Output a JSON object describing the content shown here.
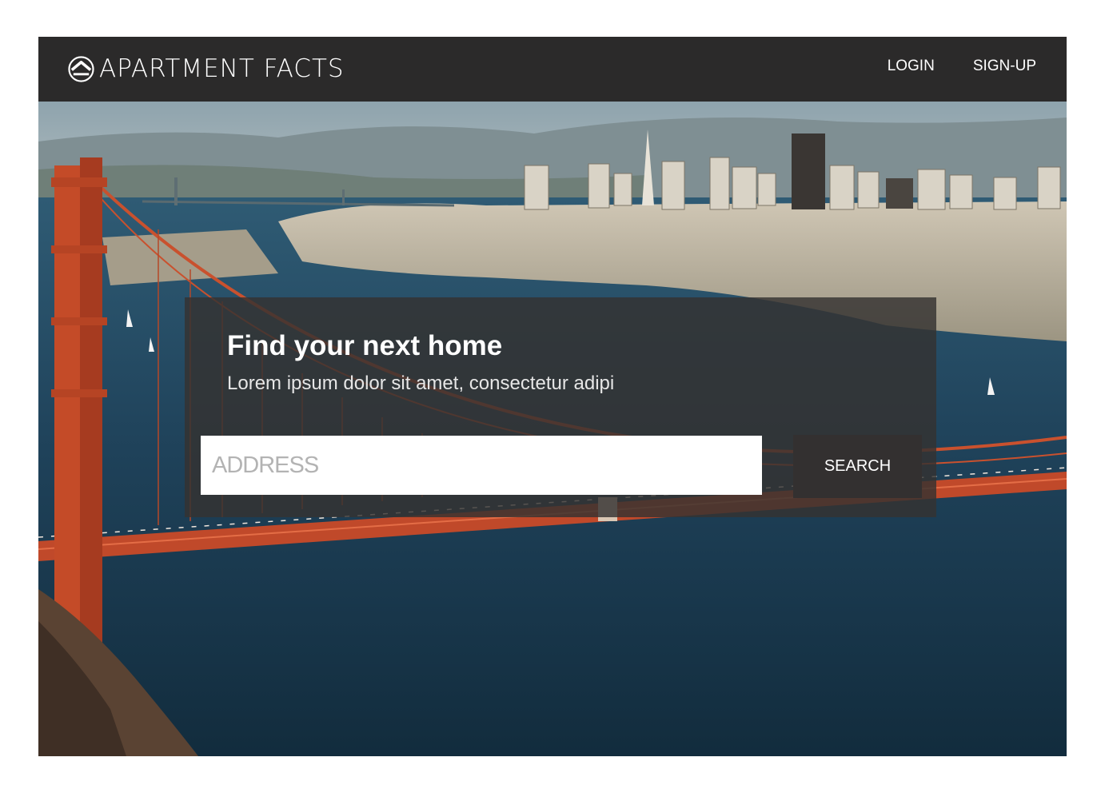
{
  "navbar": {
    "brand_name": "APARTMENT FACTS",
    "brand_icon": "house-roof-logo-icon",
    "links": [
      {
        "label": "LOGIN"
      },
      {
        "label": "SIGN-UP"
      }
    ]
  },
  "search": {
    "title": "Find your next home",
    "subtitle": "Lorem ipsum dolor sit amet, consectetur adipi",
    "address_placeholder": "ADDRESS",
    "address_value": "",
    "button_label": "SEARCH"
  },
  "colors": {
    "navbar_bg": "#2b2a2a",
    "panel_bg": "#343231",
    "button_bg": "#333030",
    "bridge": "#c9512e",
    "water": "#1c3d52"
  }
}
